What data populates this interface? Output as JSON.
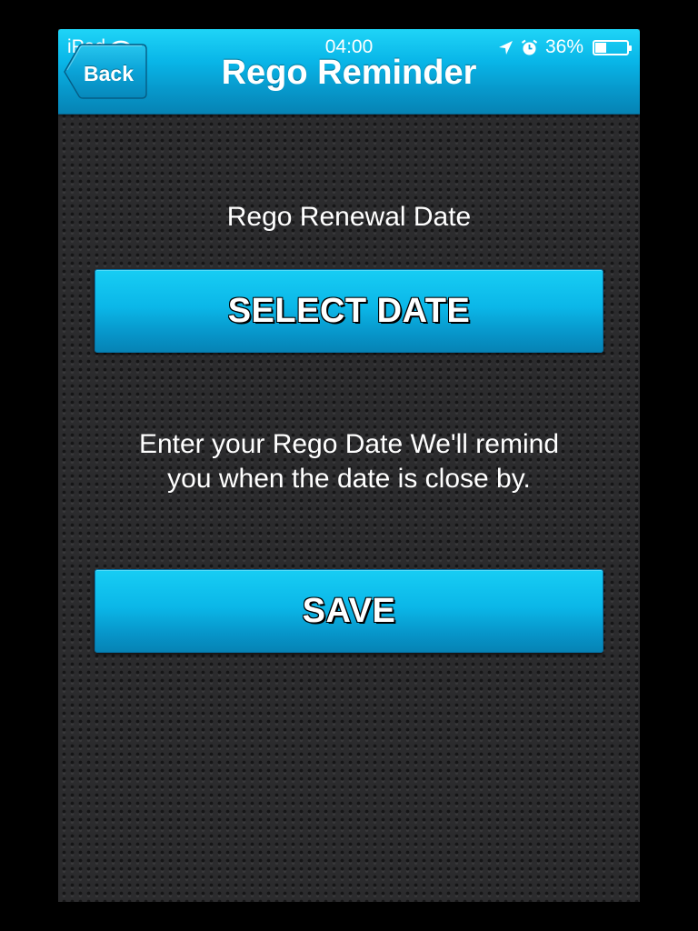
{
  "status_bar": {
    "device": "iPad",
    "time": "04:00",
    "battery": "36%",
    "battery_level": 0.36,
    "icons": [
      "wifi-icon",
      "location-arrow-icon",
      "alarm-clock-icon",
      "battery-icon"
    ]
  },
  "nav": {
    "back_label": "Back",
    "title": "Rego Reminder"
  },
  "main": {
    "renewal_label": "Rego Renewal Date",
    "select_date_label": "SELECT DATE",
    "info_line1": "Enter your Rego Date We'll remind",
    "info_line2": "you when the date is close by.",
    "save_label": "SAVE"
  },
  "colors": {
    "accent": "#0bb7e8",
    "accent_dark": "#0683b5",
    "background": "#2b2b2d"
  }
}
